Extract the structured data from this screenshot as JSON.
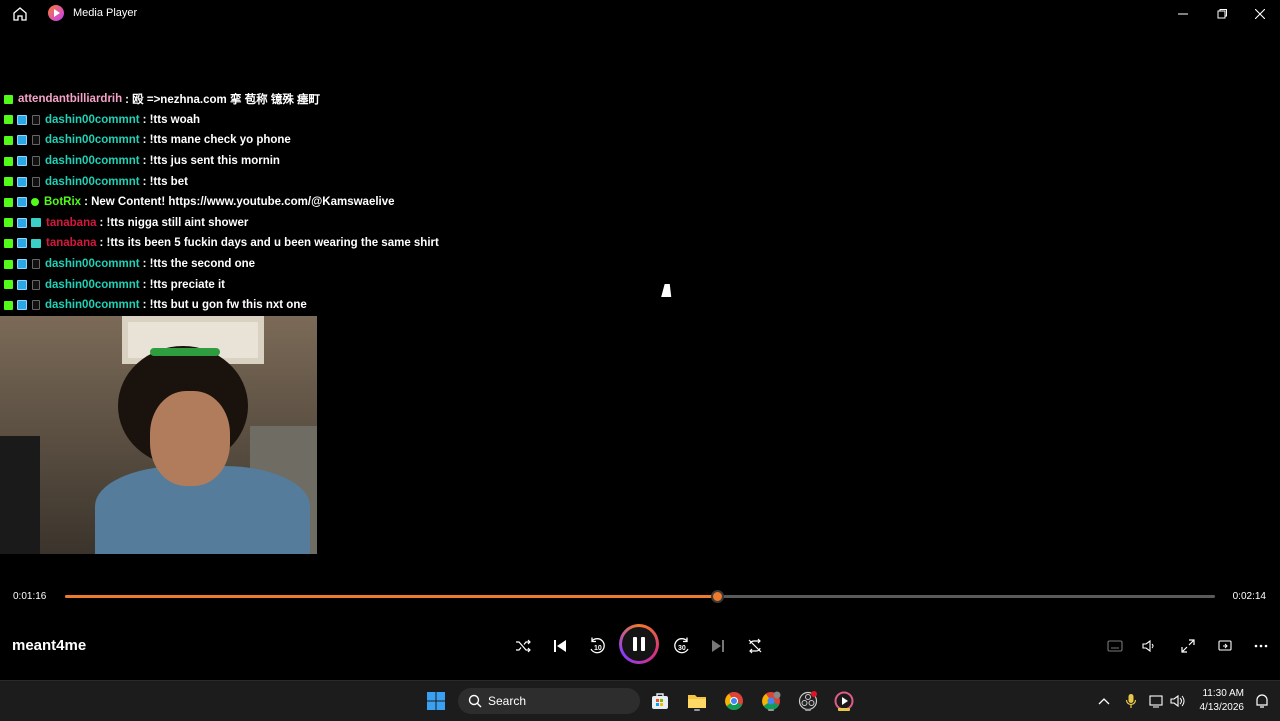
{
  "window": {
    "title": "Media Player"
  },
  "chat": {
    "messages": [
      {
        "user": "attendantbilliardrih",
        "user_color": "#f5a3c7",
        "text": ": 殴 =>nezhna.com 挛 苞称 镱殊 瘗町",
        "badges": [
          "kick"
        ]
      },
      {
        "user": "dashin00commnt",
        "user_color": "#1fd1b6",
        "text": ": !tts woah",
        "badges": [
          "kick",
          "blue",
          "dark"
        ]
      },
      {
        "user": "dashin00commnt",
        "user_color": "#1fd1b6",
        "text": ": !tts mane check yo phone",
        "badges": [
          "kick",
          "blue",
          "dark"
        ]
      },
      {
        "user": "dashin00commnt",
        "user_color": "#1fd1b6",
        "text": ": !tts jus sent this mornin",
        "badges": [
          "kick",
          "blue",
          "dark"
        ]
      },
      {
        "user": "dashin00commnt",
        "user_color": "#1fd1b6",
        "text": ": !tts bet",
        "badges": [
          "kick",
          "blue",
          "dark"
        ]
      },
      {
        "user": "BotRix",
        "user_color": "#53fc18",
        "text": ": New Content! https://www.youtube.com/@Kamswaelive",
        "badges": [
          "kick",
          "blue",
          "verify"
        ]
      },
      {
        "user": "tanabana",
        "user_color": "#d4183c",
        "text": ": !tts nigga still aint shower",
        "badges": [
          "kick",
          "blue",
          "sub"
        ]
      },
      {
        "user": "tanabana",
        "user_color": "#d4183c",
        "text": ": !tts its been 5 fuckin days and u been wearing the same shirt",
        "badges": [
          "kick",
          "blue",
          "sub"
        ]
      },
      {
        "user": "dashin00commnt",
        "user_color": "#1fd1b6",
        "text": ": !tts the second one",
        "badges": [
          "kick",
          "blue",
          "dark"
        ]
      },
      {
        "user": "dashin00commnt",
        "user_color": "#1fd1b6",
        "text": ": !tts preciate it",
        "badges": [
          "kick",
          "blue",
          "dark"
        ]
      },
      {
        "user": "dashin00commnt",
        "user_color": "#1fd1b6",
        "text": ": !tts but u gon fw this nxt one",
        "badges": [
          "kick",
          "blue",
          "dark"
        ]
      }
    ]
  },
  "player": {
    "current_time": "0:01:16",
    "total_time": "0:02:14",
    "progress": 0.567,
    "track_name": "meant4me",
    "accent": "#f07a2c",
    "skip_back_label": "10",
    "skip_forward_label": "30"
  },
  "taskbar": {
    "search_placeholder": "Search",
    "time": "11:30 AM",
    "date": "4/13/2026"
  }
}
